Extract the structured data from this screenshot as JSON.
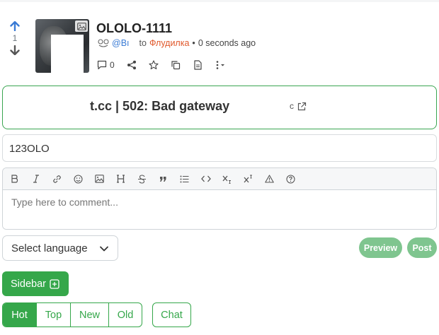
{
  "post": {
    "score": "1",
    "title": "OLOLO-1111",
    "author": "@Bı",
    "to_label": "to",
    "community": "Флудилка",
    "separator": "•",
    "time": "0 seconds ago",
    "comment_count": "0"
  },
  "link": {
    "title": "t.cc | 502: Bad gateway",
    "tail_text": "c"
  },
  "body_text": "123OLO",
  "editor": {
    "placeholder": "Type here to comment...",
    "toolbar": [
      "bold-icon",
      "italic-icon",
      "link-icon",
      "emoji-icon",
      "image-icon",
      "header-icon",
      "strikethrough-icon",
      "quote-icon",
      "list-icon",
      "code-icon",
      "subscript-icon",
      "superscript-icon",
      "spoiler-icon",
      "help-icon"
    ]
  },
  "language_select": {
    "selected": "Select language"
  },
  "buttons": {
    "preview": "Preview",
    "post": "Post",
    "sidebar": "Sidebar",
    "chat": "Chat"
  },
  "sort_tabs": [
    {
      "label": "Hot",
      "active": true
    },
    {
      "label": "Top",
      "active": false
    },
    {
      "label": "New",
      "active": false
    },
    {
      "label": "Old",
      "active": false
    }
  ],
  "colors": {
    "accent": "#35a74a",
    "accent_light": "#7fc58f",
    "link_blue": "#3a7bd5",
    "community_orange": "#e0582b",
    "upvote_blue": "#3a7bd5"
  }
}
